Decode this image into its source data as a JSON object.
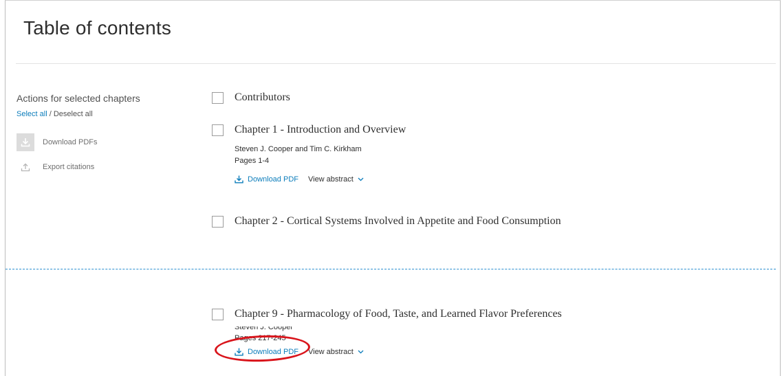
{
  "page": {
    "title": "Table of contents"
  },
  "actions": {
    "heading": "Actions for selected chapters",
    "select_all": "Select all",
    "separator": "/",
    "deselect_all": "Deselect all",
    "download_pdfs": "Download PDFs",
    "export_citations": "Export citations"
  },
  "chapters": [
    {
      "title": "Contributors"
    },
    {
      "title": "Chapter 1 - Introduction and Overview",
      "authors": "Steven J. Cooper and Tim C. Kirkham",
      "pages": "Pages 1-4",
      "download_pdf": "Download PDF",
      "view_abstract": "View abstract"
    },
    {
      "title": "Chapter 2 - Cortical Systems Involved in Appetite and Food Consumption"
    },
    {
      "title": "Chapter 9 - Pharmacology of Food, Taste, and Learned Flavor Preferences",
      "authors": "Steven J. Cooper",
      "pages": "Pages 217-245",
      "download_pdf": "Download PDF",
      "view_abstract": "View abstract"
    }
  ],
  "annotation": {
    "highlight_color": "#d9141b"
  },
  "colors": {
    "link_blue": "#0c7dbb",
    "divider_blue": "#2c8fd0"
  },
  "icons": {
    "download": "download-icon",
    "export": "export-icon",
    "chevron": "chevron-down-icon"
  }
}
